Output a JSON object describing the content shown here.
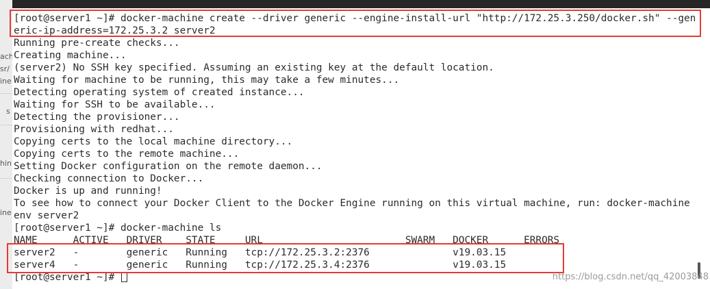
{
  "background_window": {
    "fragments": [
      "ach",
      "sr/",
      "ine",
      "s",
      "hin",
      "ine"
    ]
  },
  "terminal": {
    "lines": [
      "[root@server1 ~]# docker-machine create --driver generic --engine-install-url \"http://172.25.3.250/docker.sh\" --gen",
      "eric-ip-address=172.25.3.2 server2",
      "Running pre-create checks...",
      "Creating machine...",
      "(server2) No SSH key specified. Assuming an existing key at the default location.",
      "Waiting for machine to be running, this may take a few minutes...",
      "Detecting operating system of created instance...",
      "Waiting for SSH to be available...",
      "Detecting the provisioner...",
      "Provisioning with redhat...",
      "Copying certs to the local machine directory...",
      "Copying certs to the remote machine...",
      "Setting Docker configuration on the remote daemon...",
      "Checking connection to Docker...",
      "Docker is up and running!",
      "To see how to connect your Docker Client to the Docker Engine running on this virtual machine, run: docker-machine",
      "env server2",
      "[root@server1 ~]# docker-machine ls",
      "NAME      ACTIVE   DRIVER    STATE     URL                        SWARM   DOCKER      ERRORS",
      "server2   -        generic   Running   tcp://172.25.3.2:2376              v19.03.15",
      "server4   -        generic   Running   tcp://172.25.3.4:2376              v19.03.15"
    ],
    "prompt": "[root@server1 ~]# "
  },
  "watermark": "https://blog.csdn.net/qq_42003848",
  "colors": {
    "terminal_bg": "#ffffff",
    "terminal_text": "#2b2b2b",
    "highlight_box": "#e53935"
  }
}
